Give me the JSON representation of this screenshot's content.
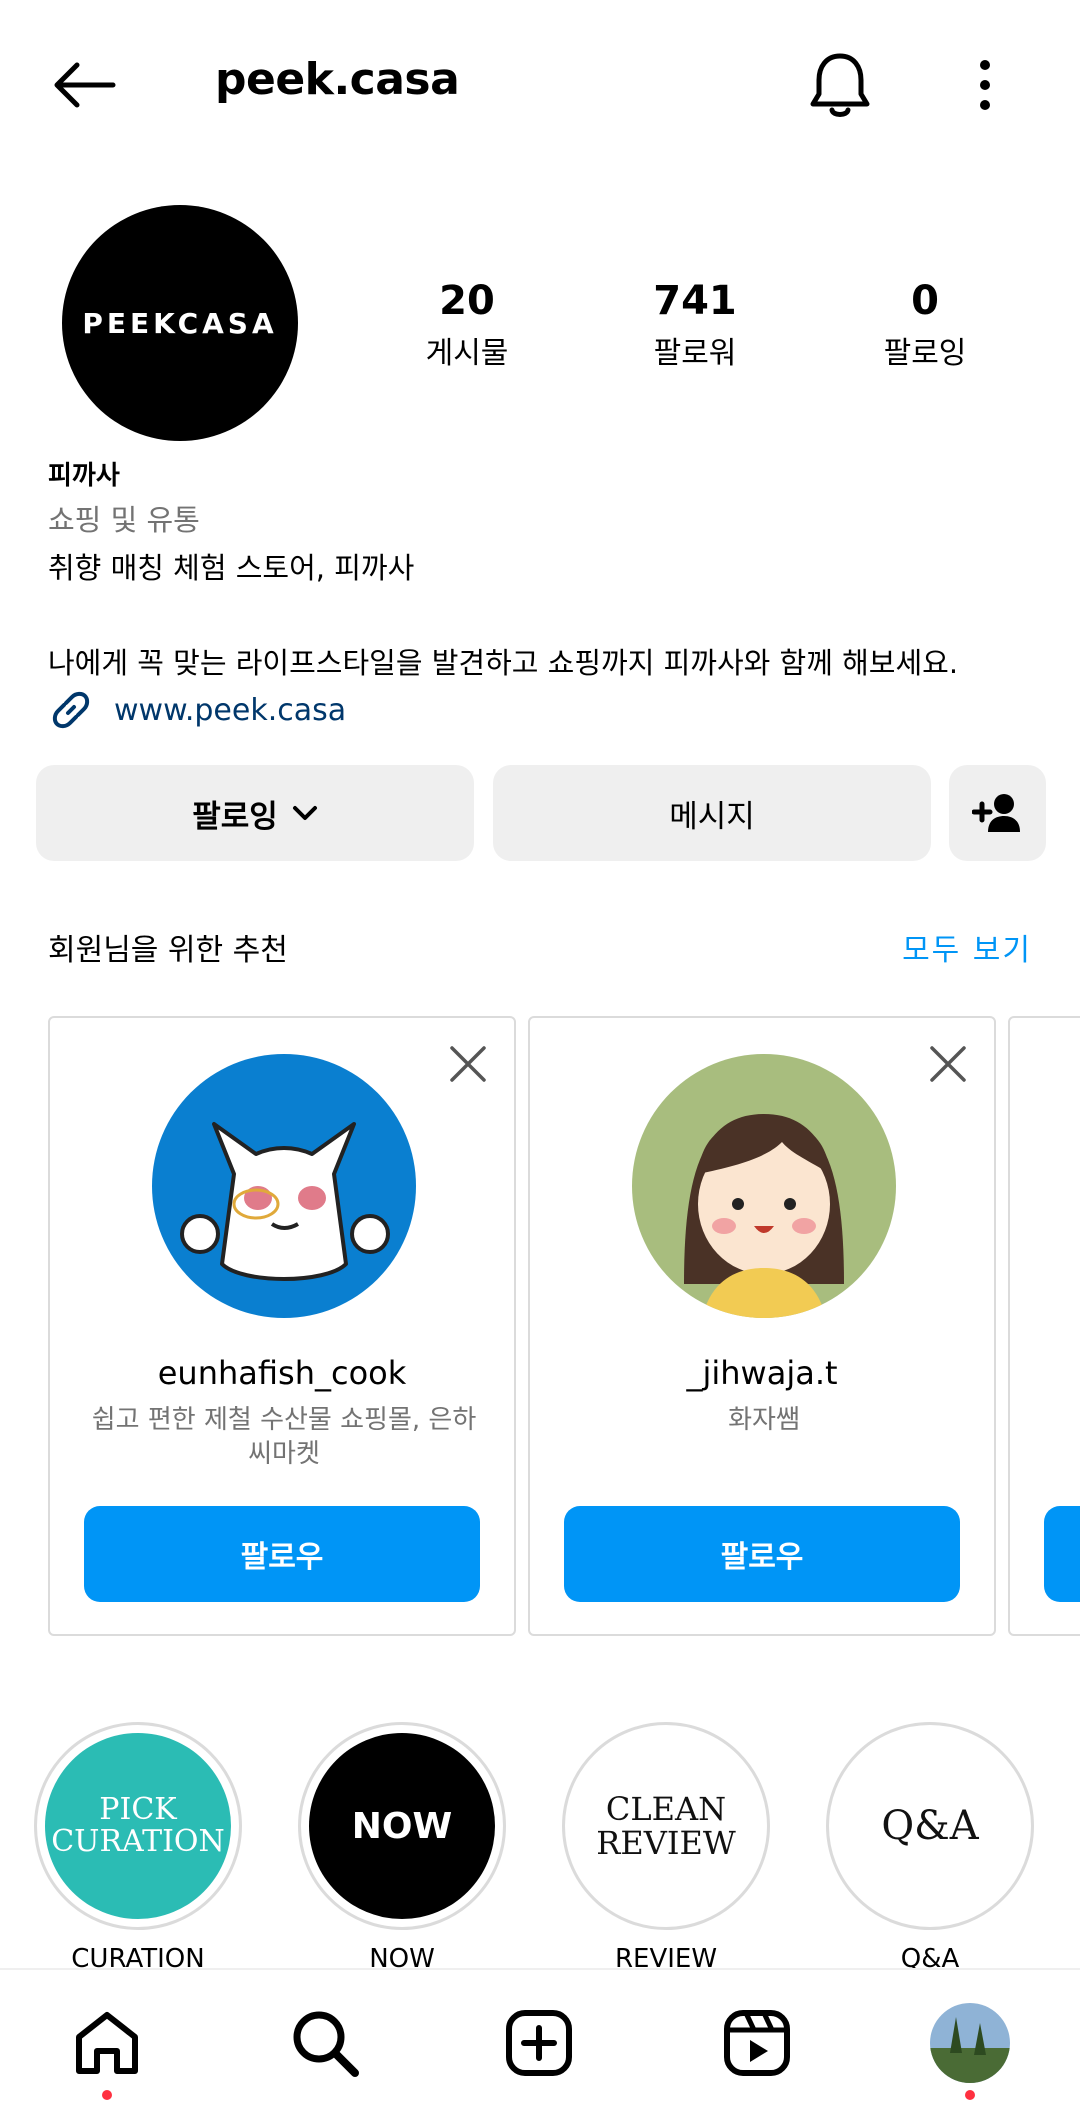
{
  "topbar": {
    "username": "peek.casa"
  },
  "profile": {
    "avatar_text": "PEEKCASA",
    "stats": {
      "posts": {
        "count": "20",
        "label": "게시물"
      },
      "followers": {
        "count": "741",
        "label": "팔로워"
      },
      "following": {
        "count": "0",
        "label": "팔로잉"
      }
    },
    "name": "피까사",
    "category": "쇼핑 및 유통",
    "bio_line1": "취향 매칭 체험 스토어, 피까사",
    "bio_line2": "나에게 꼭 맞는 라이프스타일을 발견하고 쇼핑까지 피까사와 함께 해보세요.",
    "link": "www.peek.casa"
  },
  "actions": {
    "following_label": "팔로잉",
    "message_label": "메시지"
  },
  "suggestions": {
    "title": "회원님을 위한 추천",
    "see_all": "모두 보기",
    "cards": [
      {
        "username": "eunhafish_cook",
        "description": "쉽고 편한 제철 수산물 쇼핑몰, 은하씨마켓",
        "follow_label": "팔로우"
      },
      {
        "username": "_jihwaja.t",
        "description": "화자쌤",
        "follow_label": "팔로우"
      }
    ]
  },
  "highlights": [
    {
      "label": "CURATION",
      "cover_text": "PICK\nCURATION",
      "color": "#2bbcb4"
    },
    {
      "label": "NOW",
      "cover_text": "NOW",
      "color": "#000000"
    },
    {
      "label": "REVIEW",
      "cover_text": "CLEAN\nREVIEW",
      "color": "#ffffff"
    },
    {
      "label": "Q&A",
      "cover_text": "Q&A",
      "color": "#ffffff"
    }
  ],
  "bottom_nav": [
    "home-icon",
    "search-icon",
    "create-icon",
    "reels-icon",
    "profile-avatar"
  ],
  "colors": {
    "accent": "#0095f6",
    "link": "#00376b",
    "notification_dot": "#ff3040"
  }
}
